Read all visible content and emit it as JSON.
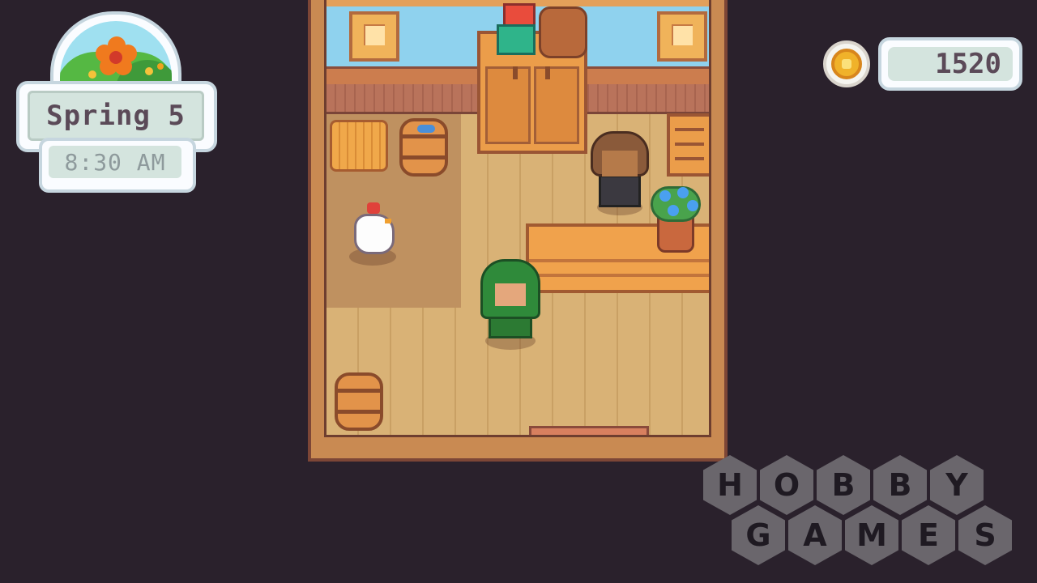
{
  "hud": {
    "date": "Spring 5",
    "time": "8:30 AM",
    "season_icon": "flower-icon",
    "gold": "1520",
    "gold_icon": "gold-coin-icon"
  },
  "watermark": {
    "row1": [
      "H",
      "O",
      "B",
      "B",
      "Y"
    ],
    "row2": [
      "G",
      "A",
      "M",
      "E",
      "S"
    ]
  }
}
